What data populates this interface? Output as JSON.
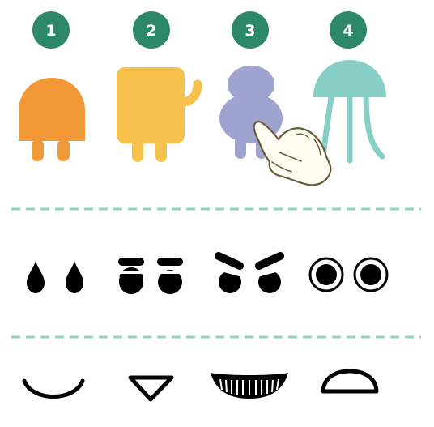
{
  "characters": [
    {
      "number": "1",
      "icon": "orange-dome-creature-icon",
      "color": "#F29837"
    },
    {
      "number": "2",
      "icon": "yellow-square-creature-icon",
      "color": "#F6C24C"
    },
    {
      "number": "3",
      "icon": "purple-blob-creature-icon",
      "color": "#9FA3CF"
    },
    {
      "number": "4",
      "icon": "teal-jellyfish-creature-icon",
      "color": "#86CEC6"
    }
  ],
  "eyes": [
    {
      "icon": "teardrop-eyes-icon"
    },
    {
      "icon": "flat-brow-eyes-icon"
    },
    {
      "icon": "angry-brow-eyes-icon"
    },
    {
      "icon": "round-ring-eyes-icon"
    }
  ],
  "mouths": [
    {
      "icon": "smile-curve-mouth-icon"
    },
    {
      "icon": "triangle-mouth-icon"
    },
    {
      "icon": "toothy-grin-mouth-icon"
    },
    {
      "icon": "half-dome-mouth-icon"
    }
  ],
  "pointer": {
    "icon": "pointing-hand-icon"
  },
  "colors": {
    "badge": "#2D8769",
    "divider": "#8FD3C1",
    "ink": "#000000"
  }
}
